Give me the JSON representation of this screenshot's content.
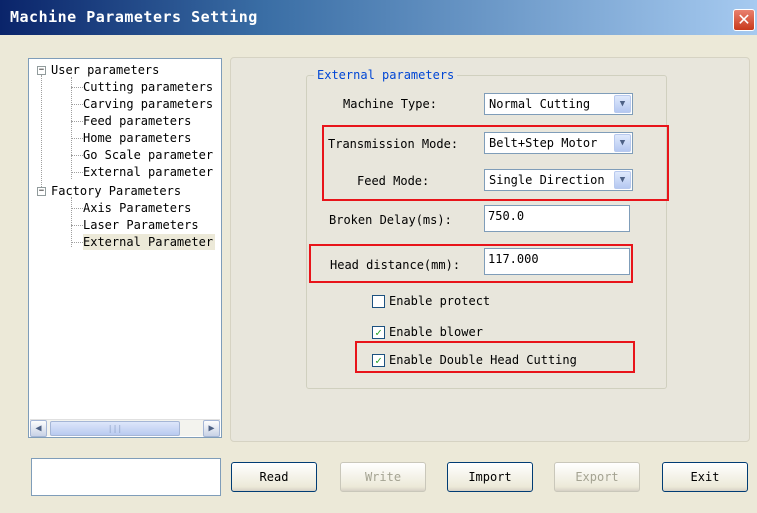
{
  "window": {
    "title": "Machine Parameters Setting",
    "close_label": "✕"
  },
  "tree": {
    "groups": [
      {
        "label": "User parameters",
        "expander": "−",
        "children": [
          "Cutting parameters",
          "Carving parameters",
          "Feed parameters",
          "Home parameters",
          "Go Scale parameter",
          "External parameter"
        ]
      },
      {
        "label": "Factory Parameters",
        "expander": "−",
        "children": [
          "Axis Parameters",
          "Laser Parameters",
          "External Parameter"
        ]
      }
    ],
    "scroll_left": "◀",
    "scroll_right": "▶",
    "scroll_grip": "|||"
  },
  "external": {
    "group_title": "External parameters",
    "machine_type": {
      "label": "Machine Type:",
      "value": "Normal Cutting"
    },
    "transmission_mode": {
      "label": "Transmission Mode:",
      "value": "Belt+Step Motor"
    },
    "feed_mode": {
      "label": "Feed Mode:",
      "value": "Single Direction"
    },
    "broken_delay": {
      "label": "Broken Delay(ms):",
      "value": "750.0"
    },
    "head_distance": {
      "label": "Head distance(mm):",
      "value": "117.000"
    },
    "enable_protect": {
      "label": "Enable protect",
      "checked": false
    },
    "enable_blower": {
      "label": "Enable blower",
      "checked": true
    },
    "enable_double_head": {
      "label": "Enable Double Head Cutting",
      "checked": true
    },
    "dropdown_glyph": "▼",
    "check_glyph": "✓"
  },
  "buttons": {
    "read": "Read",
    "write": "Write",
    "import": "Import",
    "export": "Export",
    "exit": "Exit"
  },
  "colors": {
    "highlight_box": "#e8141a",
    "group_title": "#0046d5"
  }
}
